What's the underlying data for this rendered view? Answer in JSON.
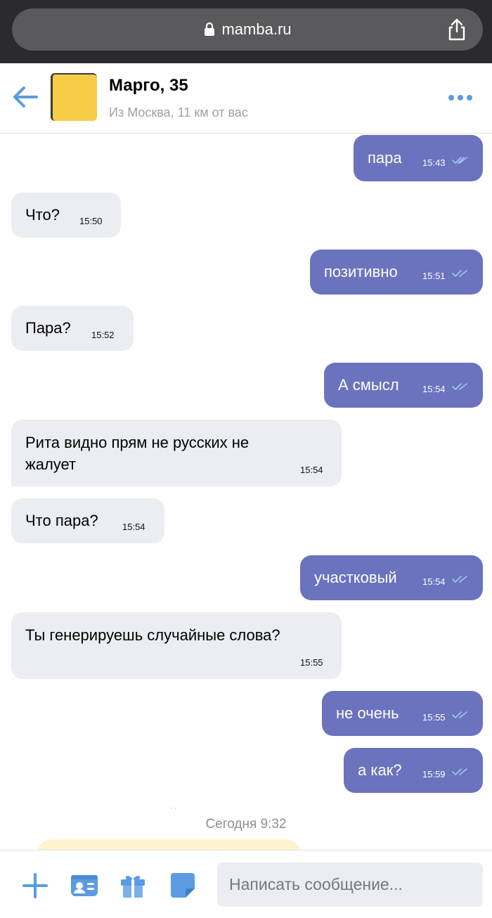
{
  "browser": {
    "url": "mamba.ru"
  },
  "header": {
    "name": "Марго, 35",
    "subtitle": "Из Москва, 11 км от вас"
  },
  "messages": [
    {
      "dir": "out",
      "text": "пара",
      "time": "15:43"
    },
    {
      "dir": "in",
      "text": "Что?",
      "time": "15:50"
    },
    {
      "dir": "out",
      "text": "позитивно",
      "time": "15:51"
    },
    {
      "dir": "in",
      "text": "Пара?",
      "time": "15:52"
    },
    {
      "dir": "out",
      "text": "А смысл",
      "time": "15:54"
    },
    {
      "dir": "in",
      "text": "Рита видно прям не русских не жалует",
      "time": "15:54"
    },
    {
      "dir": "in",
      "text": "Что пара?",
      "time": "15:54"
    },
    {
      "dir": "out",
      "text": "участковый",
      "time": "15:54"
    },
    {
      "dir": "in",
      "text": "Ты генерируешь случайные слова?",
      "time": "15:55"
    },
    {
      "dir": "out",
      "text": "не очень",
      "time": "15:55"
    },
    {
      "dir": "out",
      "text": "а как?",
      "time": "15:59"
    }
  ],
  "date_divider": "Сегодня 9:32",
  "composer": {
    "placeholder": "Написать сообщение..."
  },
  "icons": {
    "lock": "lock-icon",
    "share": "share-icon",
    "back": "back-arrow-icon",
    "more": "more-dots-icon",
    "add": "plus-icon",
    "profile": "profile-card-icon",
    "gift": "gift-icon",
    "sticker": "sticker-icon",
    "read": "double-check-icon"
  },
  "colors": {
    "accent": "#5b9be1",
    "outgoing_bubble": "#6b73be",
    "incoming_bubble": "#ebedf3",
    "avatar": "#f7cd47"
  }
}
